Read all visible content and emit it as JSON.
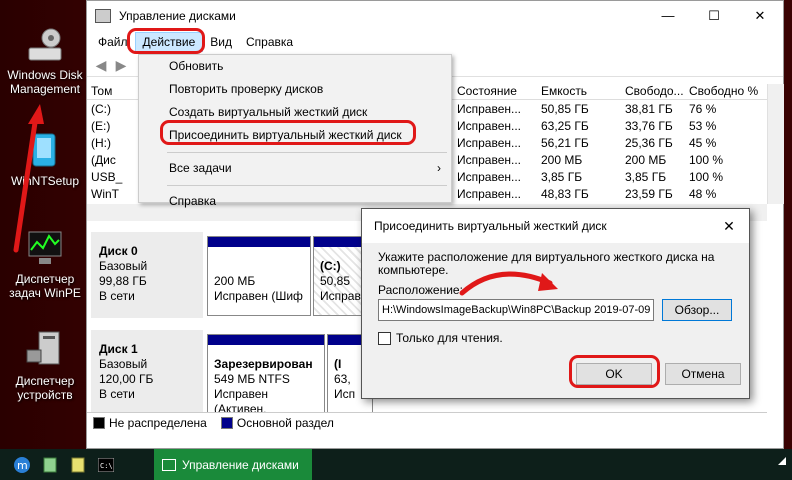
{
  "desktop": {
    "icons": [
      {
        "label": "Windows Disk Management"
      },
      {
        "label": "WinNTSetup"
      },
      {
        "label": "Диспетчер задач WinPE"
      },
      {
        "label": "Диспетчер устройств"
      }
    ]
  },
  "window": {
    "title": "Управление дисками",
    "menu": [
      "Файл",
      "Действие",
      "Вид",
      "Справка"
    ]
  },
  "table": {
    "headers": [
      "Том",
      "",
      "Состояние",
      "Емкость",
      "Свободо...",
      "Свободно %"
    ],
    "rows": [
      {
        "vol": "(C:)",
        "state": "Исправен...",
        "cap": "50,85 ГБ",
        "free": "38,81 ГБ",
        "pct": "76 %"
      },
      {
        "vol": "(E:)",
        "state": "Исправен...",
        "cap": "63,25 ГБ",
        "free": "33,76 ГБ",
        "pct": "53 %"
      },
      {
        "vol": "(H:)",
        "state": "Исправен...",
        "cap": "56,21 ГБ",
        "free": "25,36 ГБ",
        "pct": "45 %"
      },
      {
        "vol": "(Дис",
        "state": "Исправен...",
        "cap": "200 МБ",
        "free": "200 МБ",
        "pct": "100 %"
      },
      {
        "vol": "USB_",
        "state": "Исправен...",
        "cap": "3,85 ГБ",
        "free": "3,85 ГБ",
        "pct": "100 %"
      },
      {
        "vol": "WinT",
        "state": "Исправен...",
        "cap": "48,83 ГБ",
        "free": "23,59 ГБ",
        "pct": "48 %"
      }
    ]
  },
  "menu": {
    "items": [
      "Обновить",
      "Повторить проверку дисков",
      "Создать виртуальный жесткий диск",
      "Присоединить виртуальный жесткий диск",
      "Все задачи",
      "Справка"
    ],
    "submenu_arrow": "›"
  },
  "disks": [
    {
      "name": "Диск 0",
      "type": "Базовый",
      "size": "99,88 ГБ",
      "status": "В сети",
      "parts": [
        {
          "l1": "",
          "l2": "200 МБ",
          "l3": "Исправен (Шиф"
        },
        {
          "l1": "(C:)",
          "l2": "50,85 ",
          "l3": "Исправ"
        }
      ]
    },
    {
      "name": "Диск 1",
      "type": "Базовый",
      "size": "120,00 ГБ",
      "status": "В сети",
      "parts": [
        {
          "l1": "Зарезервирован",
          "l2": "549 МБ NTFS",
          "l3": "Исправен (Активен,"
        },
        {
          "l1": "(I",
          "l2": "63,",
          "l3": "Исп"
        }
      ]
    }
  ],
  "legend": [
    "Не распределена",
    "Основной раздел"
  ],
  "dialog": {
    "title": "Присоединить виртуальный жесткий диск",
    "instruction_l1": "Укажите расположение для виртуального жесткого диска на",
    "instruction_l2": "компьютере.",
    "location_label": "Расположение:",
    "path": "H:\\WindowsImageBackup\\Win8PC\\Backup 2019-07-09",
    "browse": "Обзор...",
    "readonly": "Только для чтения.",
    "ok": "OK",
    "cancel": "Отмена"
  },
  "taskbar": {
    "app_label": "Управление дисками"
  },
  "colors": {
    "highlight": "#e01818",
    "primary_partition": "#00008b",
    "taskbar_app": "#1a8a3a"
  }
}
